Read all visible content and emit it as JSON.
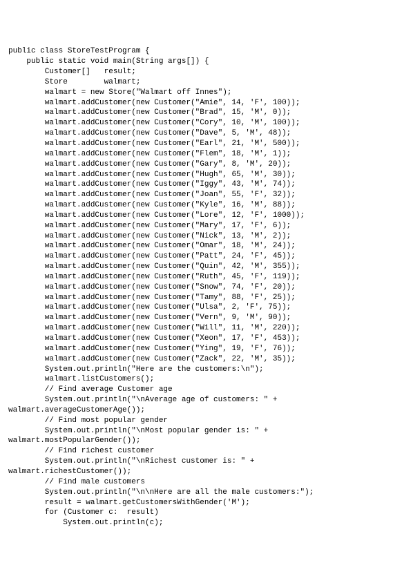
{
  "lines": [
    "public class StoreTestProgram {",
    "    public static void main(String args[]) {",
    "        Customer[]   result;",
    "        Store        walmart;",
    "",
    "        walmart = new Store(\"Walmart off Innes\");",
    "        walmart.addCustomer(new Customer(\"Amie\", 14, 'F', 100));",
    "        walmart.addCustomer(new Customer(\"Brad\", 15, 'M', 0));",
    "        walmart.addCustomer(new Customer(\"Cory\", 10, 'M', 100));",
    "        walmart.addCustomer(new Customer(\"Dave\", 5, 'M', 48));",
    "        walmart.addCustomer(new Customer(\"Earl\", 21, 'M', 500));",
    "        walmart.addCustomer(new Customer(\"Flem\", 18, 'M', 1));",
    "        walmart.addCustomer(new Customer(\"Gary\", 8, 'M', 20));",
    "        walmart.addCustomer(new Customer(\"Hugh\", 65, 'M', 30));",
    "        walmart.addCustomer(new Customer(\"Iggy\", 43, 'M', 74));",
    "        walmart.addCustomer(new Customer(\"Joan\", 55, 'F', 32));",
    "        walmart.addCustomer(new Customer(\"Kyle\", 16, 'M', 88));",
    "        walmart.addCustomer(new Customer(\"Lore\", 12, 'F', 1000));",
    "        walmart.addCustomer(new Customer(\"Mary\", 17, 'F', 6));",
    "        walmart.addCustomer(new Customer(\"Nick\", 13, 'M', 2));",
    "        walmart.addCustomer(new Customer(\"Omar\", 18, 'M', 24));",
    "        walmart.addCustomer(new Customer(\"Patt\", 24, 'F', 45));",
    "        walmart.addCustomer(new Customer(\"Quin\", 42, 'M', 355));",
    "        walmart.addCustomer(new Customer(\"Ruth\", 45, 'F', 119));",
    "        walmart.addCustomer(new Customer(\"Snow\", 74, 'F', 20));",
    "        walmart.addCustomer(new Customer(\"Tamy\", 88, 'F', 25));",
    "        walmart.addCustomer(new Customer(\"Ulsa\", 2, 'F', 75));",
    "        walmart.addCustomer(new Customer(\"Vern\", 9, 'M', 90));",
    "        walmart.addCustomer(new Customer(\"Will\", 11, 'M', 220));",
    "        walmart.addCustomer(new Customer(\"Xeon\", 17, 'F', 453));",
    "        walmart.addCustomer(new Customer(\"Ying\", 19, 'F', 76));",
    "        walmart.addCustomer(new Customer(\"Zack\", 22, 'M', 35));",
    "        System.out.println(\"Here are the customers:\\n\");",
    "        walmart.listCustomers();",
    "",
    "        // Find average Customer age",
    "        System.out.println(\"\\nAverage age of customers: \" +",
    "walmart.averageCustomerAge());",
    "",
    "        // Find most popular gender",
    "        System.out.println(\"\\nMost popular gender is: \" +",
    "walmart.mostPopularGender());",
    "",
    "        // Find richest customer",
    "        System.out.println(\"\\nRichest customer is: \" +",
    "walmart.richestCustomer());",
    "",
    "        // Find male customers",
    "        System.out.println(\"\\n\\nHere are all the male customers:\");",
    "        result = walmart.getCustomersWithGender('M');",
    "        for (Customer c:  result)",
    "            System.out.println(c);"
  ]
}
